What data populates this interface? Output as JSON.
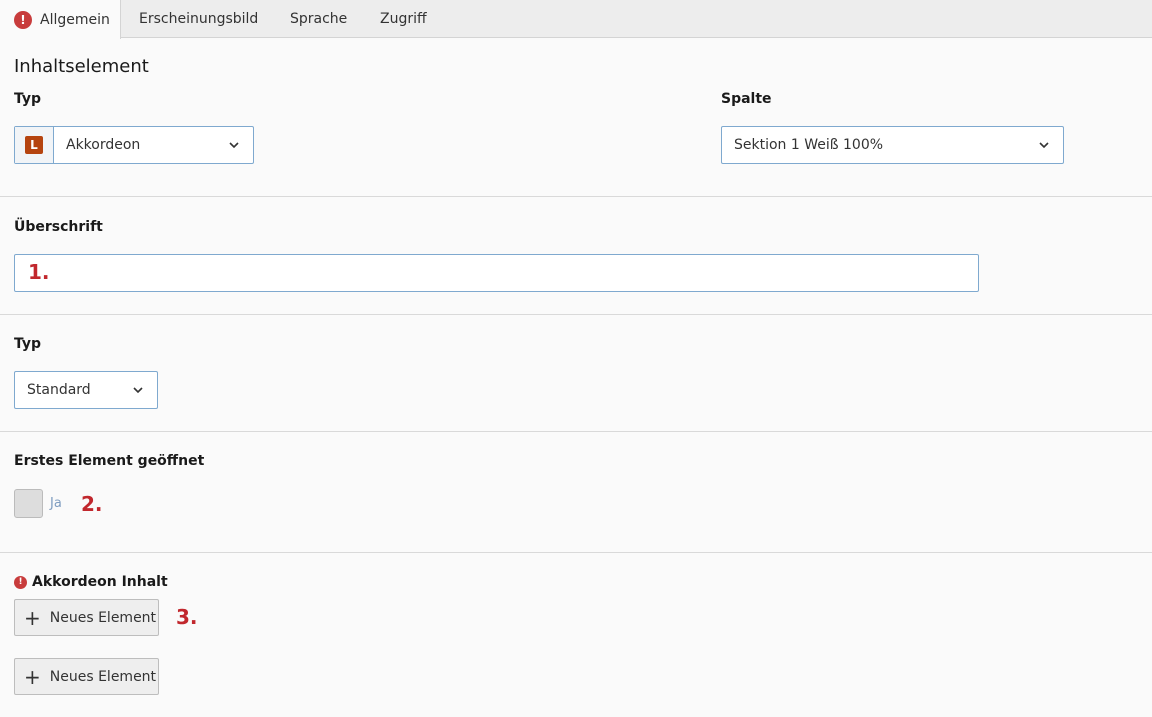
{
  "tabs": [
    {
      "label": "Allgemein",
      "active": true,
      "has_error": true
    },
    {
      "label": "Erscheinungsbild",
      "active": false
    },
    {
      "label": "Sprache",
      "active": false
    },
    {
      "label": "Zugriff",
      "active": false
    }
  ],
  "section": {
    "title": "Inhaltselement"
  },
  "typ_field": {
    "label": "Typ",
    "value": "Akkordeon",
    "icon": "L"
  },
  "spalte_field": {
    "label": "Spalte",
    "value": "Sektion 1 Weiß 100%"
  },
  "ueberschrift_field": {
    "label": "Überschrift",
    "value": ""
  },
  "typ2_field": {
    "label": "Typ",
    "value": "Standard"
  },
  "erstes_field": {
    "label": "Erstes Element geöffnet",
    "checkbox_label": "Ja",
    "checked": false
  },
  "akkordeon_field": {
    "label": "Akkordeon Inhalt",
    "has_error": true
  },
  "buttons": {
    "new_element_1": "Neues Element",
    "new_element_2": "Neues Element"
  },
  "annotations": {
    "a1": "1.",
    "a2": "2.",
    "a3": "3."
  },
  "colors": {
    "error": "#c83c3c",
    "annotation": "#c1272d",
    "accent_border": "#7fa9cf",
    "type_icon": "#b5440f"
  }
}
